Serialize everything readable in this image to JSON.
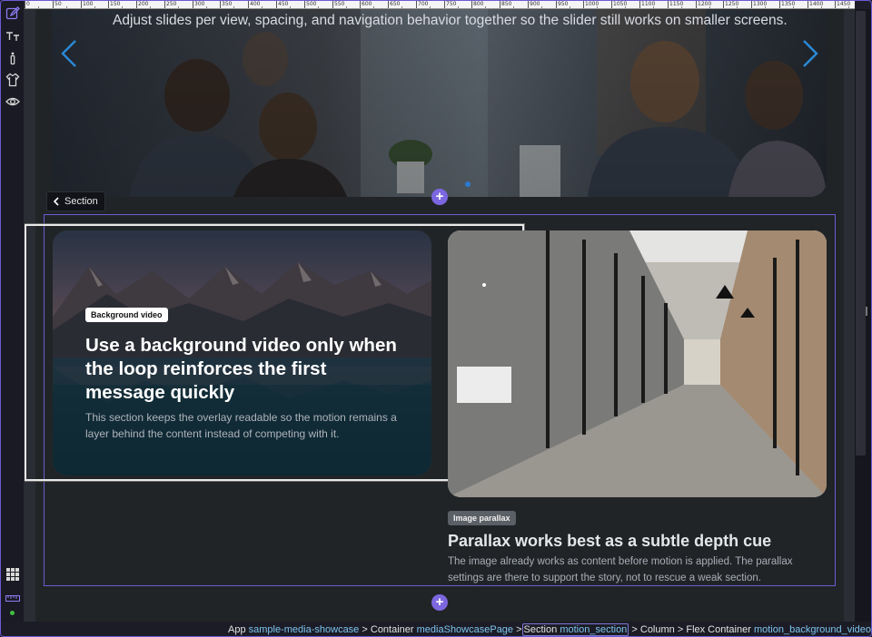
{
  "ruler": {
    "labels": [
      "0",
      "50",
      "100",
      "150",
      "200",
      "250",
      "300",
      "350",
      "400",
      "450",
      "500",
      "550",
      "600",
      "650",
      "700",
      "750",
      "800",
      "850",
      "900",
      "950",
      "1000",
      "1050",
      "1100",
      "1150",
      "1200",
      "1250",
      "1300",
      "1350",
      "1400",
      "1450"
    ]
  },
  "toolbar": {
    "icons": [
      "edit-icon",
      "typography-icon",
      "info-icon",
      "style-icon",
      "preview-icon"
    ],
    "bottom_icons": [
      "grid-icon",
      "ruler-icon",
      "status-dot-icon"
    ],
    "accent": "#7c6bdc"
  },
  "hero": {
    "caption": "Adjust slides per view, spacing, and navigation behavior together so the slider still works on smaller screens.",
    "arrow_color": "#2a8ad8"
  },
  "section_chip": {
    "label": "Section"
  },
  "add_button": {
    "label": "+"
  },
  "video_block": {
    "badge": "Background video",
    "title": "Use a background video only when the loop reinforces the first message quickly",
    "text": "This section keeps the overlay readable so the motion remains a layer behind the content instead of competing with it."
  },
  "parallax_block": {
    "badge": "Image parallax",
    "title": "Parallax works best as a subtle depth cue",
    "text": "The image already works as content before motion is applied. The parallax settings are there to support the story, not to rescue a weak section."
  },
  "breadcrumb": {
    "app_label": "App",
    "app_value": "sample-media-showcase",
    "sep": ">",
    "container_label": "Container",
    "container_value": "mediaShowcasePage",
    "section_label": "Section",
    "section_value": "motion_section",
    "column_label": "Column",
    "flex_label": "Flex Container",
    "flex_value": "motion_background_video"
  },
  "colors": {
    "selection": "#6a5cd0",
    "link": "#7dc4ee",
    "canvas": "#212427"
  }
}
